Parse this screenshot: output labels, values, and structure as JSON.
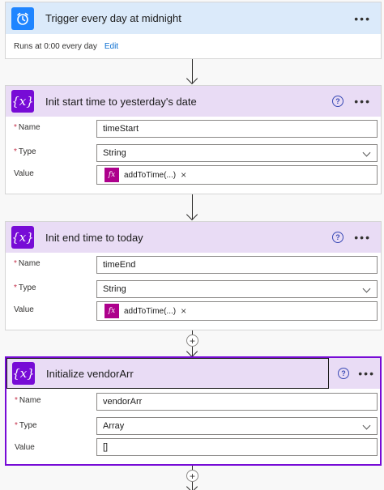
{
  "trigger": {
    "title": "Trigger every day at midnight",
    "schedule_text": "Runs at 0:00 every day",
    "edit_label": "Edit",
    "more_label": "•••"
  },
  "steps": [
    {
      "title": "Init start time to yesterday's date",
      "name_label": "Name",
      "name_value": "timeStart",
      "type_label": "Type",
      "type_value": "String",
      "value_label": "Value",
      "token_label": "addToTime(...)"
    },
    {
      "title": "Init end time to today",
      "name_label": "Name",
      "name_value": "timeEnd",
      "type_label": "Type",
      "type_value": "String",
      "value_label": "Value",
      "token_label": "addToTime(...)"
    },
    {
      "title": "Initialize vendorArr",
      "name_label": "Name",
      "name_value": "vendorArr",
      "type_label": "Type",
      "type_value": "Array",
      "value_label": "Value",
      "value_text": "[]"
    }
  ],
  "ui": {
    "required_mark": "*",
    "help_glyph": "?",
    "more_glyph": "•••",
    "token_glyph": "fx",
    "remove_glyph": "×",
    "variable_glyph": "{x}",
    "plus_glyph": "+"
  },
  "colors": {
    "trigger_header": "#dbeafa",
    "trigger_icon": "#1f85ff",
    "variable_header": "#e9dcf5",
    "variable_icon": "#770bd6",
    "expression_token": "#ad008c",
    "required": "#c4314b",
    "link": "#0a6ed1"
  },
  "icons": {
    "trigger": "alarm-clock-icon",
    "variable": "variable-icon",
    "expression": "function-icon",
    "help": "help-circle-icon",
    "more": "more-options-icon",
    "dropdown": "chevron-down-icon",
    "add": "plus-icon"
  }
}
